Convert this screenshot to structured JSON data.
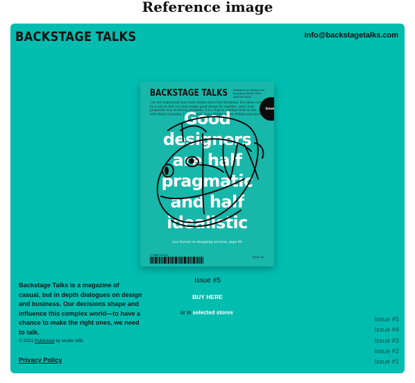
{
  "reference_title": "Reference image",
  "header": {
    "logo": "BACKSTAGE TALKS",
    "email": "info@backstagetalks.com"
  },
  "cover": {
    "logo": "BACKSTAGE TALKS",
    "tagline": "Dialogues on Design and Business ISSUE FIVE / WINTER 2021",
    "blurb": "I do not understand how Satie thinks about Piet Mondrian. But there could be a way to find out what makes good design fly together, and a very pragmatic way of solving problems. It is a way to combine both as one. Also with Maria Gonzales, Lisa Wessels, Jonas Wilder, Mateo Wilden and more.",
    "badge": "Issue 5",
    "headline": [
      "Good",
      "designers",
      "are half",
      "pragmatic",
      "and half",
      "idealistic"
    ],
    "credit": "Lou Dorsey on designing services, page 84",
    "issue_small": "ISSUE #5",
    "barcode_number": "9 789887 001071"
  },
  "current_issue": "Issue #5",
  "buy_label": "BUY HERE",
  "stores_prefix": "or in",
  "stores_link": "selected stores",
  "stores_suffix": ".",
  "description": "Backstage Talks is a magazine of casual, but in depth dialogues on design and business. Our decisions shape and influence this complex world—to have a chance to make the right ones, we need to talk.",
  "copyright_prefix": "© 2021",
  "copyright_link": "Published",
  "copyright_suffix": "by studio Milk",
  "privacy_label": "Privacy Policy",
  "issues": [
    "Issue #5",
    "Issue #4",
    "Issue #3",
    "Issue #2",
    "Issue #1"
  ],
  "colors": {
    "accent": "#00bdb0",
    "text": "#111111",
    "link": "#ffffff"
  }
}
